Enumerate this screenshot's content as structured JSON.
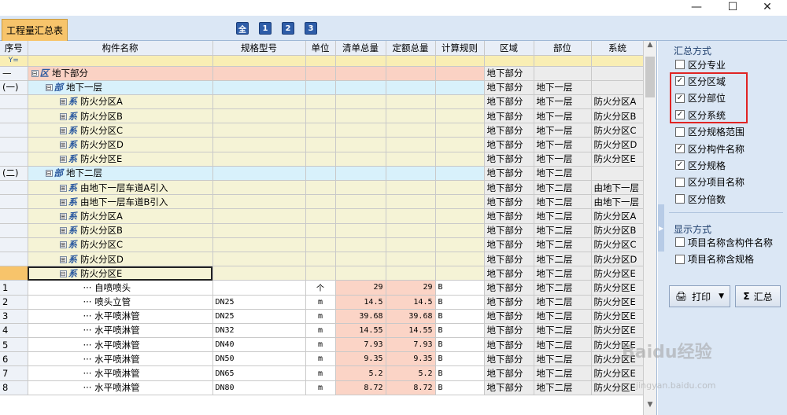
{
  "window": {
    "minimize": "—",
    "maximize": "☐",
    "close": "✕"
  },
  "toolbar": {
    "tab_label": "工程量汇总表",
    "level_buttons": [
      "全",
      "1",
      "2",
      "3"
    ]
  },
  "grid": {
    "headers": [
      "序号",
      "构件名称",
      "规格型号",
      "单位",
      "清单总量",
      "定额总量",
      "计算规则",
      "区域",
      "部位",
      "系统"
    ],
    "filter_icon": "filter-icon",
    "rows": [
      {
        "kind": "pink",
        "seq": "—",
        "exp": "⊟",
        "tag": "区",
        "name": "地下部分",
        "indent": 0,
        "region": "地下部分",
        "part": "",
        "system": ""
      },
      {
        "kind": "blue",
        "seq": "(一)",
        "exp": "⊟",
        "tag": "部",
        "name": "地下一层",
        "indent": 1,
        "region": "地下部分",
        "part": "地下一层",
        "system": ""
      },
      {
        "kind": "yellow",
        "seq": "",
        "exp": "⊞",
        "tag": "系",
        "name": "防火分区A",
        "indent": 2,
        "region": "地下部分",
        "part": "地下一层",
        "system": "防火分区A"
      },
      {
        "kind": "yellow",
        "seq": "",
        "exp": "⊞",
        "tag": "系",
        "name": "防火分区B",
        "indent": 2,
        "region": "地下部分",
        "part": "地下一层",
        "system": "防火分区B"
      },
      {
        "kind": "yellow",
        "seq": "",
        "exp": "⊞",
        "tag": "系",
        "name": "防火分区C",
        "indent": 2,
        "region": "地下部分",
        "part": "地下一层",
        "system": "防火分区C"
      },
      {
        "kind": "yellow",
        "seq": "",
        "exp": "⊞",
        "tag": "系",
        "name": "防火分区D",
        "indent": 2,
        "region": "地下部分",
        "part": "地下一层",
        "system": "防火分区D"
      },
      {
        "kind": "yellow",
        "seq": "",
        "exp": "⊞",
        "tag": "系",
        "name": "防火分区E",
        "indent": 2,
        "region": "地下部分",
        "part": "地下一层",
        "system": "防火分区E"
      },
      {
        "kind": "blue",
        "seq": "(二)",
        "exp": "⊟",
        "tag": "部",
        "name": "地下二层",
        "indent": 1,
        "region": "地下部分",
        "part": "地下二层",
        "system": ""
      },
      {
        "kind": "yellow",
        "seq": "",
        "exp": "⊞",
        "tag": "系",
        "name": "由地下一层车道A引入",
        "indent": 2,
        "region": "地下部分",
        "part": "地下二层",
        "system": "由地下一层"
      },
      {
        "kind": "yellow",
        "seq": "",
        "exp": "⊞",
        "tag": "系",
        "name": "由地下一层车道B引入",
        "indent": 2,
        "region": "地下部分",
        "part": "地下二层",
        "system": "由地下一层"
      },
      {
        "kind": "yellow",
        "seq": "",
        "exp": "⊞",
        "tag": "系",
        "name": "防火分区A",
        "indent": 2,
        "region": "地下部分",
        "part": "地下二层",
        "system": "防火分区A"
      },
      {
        "kind": "yellow",
        "seq": "",
        "exp": "⊞",
        "tag": "系",
        "name": "防火分区B",
        "indent": 2,
        "region": "地下部分",
        "part": "地下二层",
        "system": "防火分区B"
      },
      {
        "kind": "yellow",
        "seq": "",
        "exp": "⊞",
        "tag": "系",
        "name": "防火分区C",
        "indent": 2,
        "region": "地下部分",
        "part": "地下二层",
        "system": "防火分区C"
      },
      {
        "kind": "yellow",
        "seq": "",
        "exp": "⊞",
        "tag": "系",
        "name": "防火分区D",
        "indent": 2,
        "region": "地下部分",
        "part": "地下二层",
        "system": "防火分区D"
      },
      {
        "kind": "yellow",
        "seq": "",
        "exp": "⊟",
        "tag": "系",
        "name": "防火分区E",
        "indent": 2,
        "region": "地下部分",
        "part": "地下二层",
        "system": "防火分区E",
        "selected": true
      },
      {
        "kind": "item",
        "seq": "1",
        "name": "自喷喷头",
        "spec": "",
        "unit": "个",
        "qty": "29",
        "quota": "29",
        "rule": "B",
        "region": "地下部分",
        "part": "地下二层",
        "system": "防火分区E"
      },
      {
        "kind": "item",
        "seq": "2",
        "name": "喷头立管",
        "spec": "DN25",
        "unit": "m",
        "qty": "14.5",
        "quota": "14.5",
        "rule": "B",
        "region": "地下部分",
        "part": "地下二层",
        "system": "防火分区E"
      },
      {
        "kind": "item",
        "seq": "3",
        "name": "水平喷淋管",
        "spec": "DN25",
        "unit": "m",
        "qty": "39.68",
        "quota": "39.68",
        "rule": "B",
        "region": "地下部分",
        "part": "地下二层",
        "system": "防火分区E"
      },
      {
        "kind": "item",
        "seq": "4",
        "name": "水平喷淋管",
        "spec": "DN32",
        "unit": "m",
        "qty": "14.55",
        "quota": "14.55",
        "rule": "B",
        "region": "地下部分",
        "part": "地下二层",
        "system": "防火分区E"
      },
      {
        "kind": "item",
        "seq": "5",
        "name": "水平喷淋管",
        "spec": "DN40",
        "unit": "m",
        "qty": "7.93",
        "quota": "7.93",
        "rule": "B",
        "region": "地下部分",
        "part": "地下二层",
        "system": "防火分区E"
      },
      {
        "kind": "item",
        "seq": "6",
        "name": "水平喷淋管",
        "spec": "DN50",
        "unit": "m",
        "qty": "9.35",
        "quota": "9.35",
        "rule": "B",
        "region": "地下部分",
        "part": "地下二层",
        "system": "防火分区E"
      },
      {
        "kind": "item",
        "seq": "7",
        "name": "水平喷淋管",
        "spec": "DN65",
        "unit": "m",
        "qty": "5.2",
        "quota": "5.2",
        "rule": "B",
        "region": "地下部分",
        "part": "地下二层",
        "system": "防火分区E"
      },
      {
        "kind": "item",
        "seq": "8",
        "name": "水平喷淋管",
        "spec": "DN80",
        "unit": "m",
        "qty": "8.72",
        "quota": "8.72",
        "rule": "B",
        "region": "地下部分",
        "part": "地下二层",
        "system": "防火分区E"
      }
    ]
  },
  "panel": {
    "summary_title": "汇总方式",
    "summary_options": [
      {
        "label": "区分专业",
        "checked": false
      },
      {
        "label": "区分区域",
        "checked": true
      },
      {
        "label": "区分部位",
        "checked": true
      },
      {
        "label": "区分系统",
        "checked": true
      },
      {
        "label": "区分规格范围",
        "checked": false
      },
      {
        "label": "区分构件名称",
        "checked": true
      },
      {
        "label": "区分规格",
        "checked": true
      },
      {
        "label": "区分项目名称",
        "checked": false
      },
      {
        "label": "区分倍数",
        "checked": false
      }
    ],
    "display_title": "显示方式",
    "display_options": [
      {
        "label": "项目名称含构件名称",
        "checked": false
      },
      {
        "label": "项目名称含规格",
        "checked": false
      }
    ],
    "print_label": "打印",
    "summary_label": "汇总"
  },
  "watermark": {
    "main": "Baidu经验",
    "sub": "jingyan.baidu.com"
  },
  "colors": {
    "accent_tab": "#f7c46b",
    "region_pink": "#fad2c4",
    "part_blue": "#d8f1fb",
    "system_yellow": "#f5f3d6",
    "highlight_red": "#e02424"
  }
}
